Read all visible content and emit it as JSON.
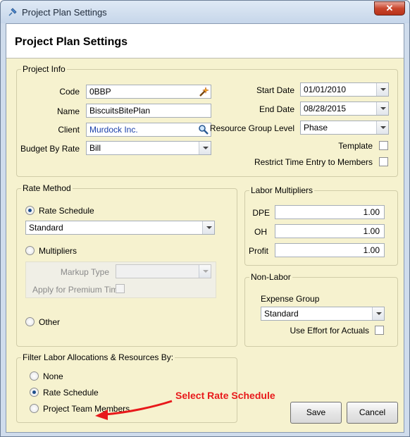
{
  "window": {
    "title": "Project Plan Settings",
    "close_glyph": "✕"
  },
  "header": {
    "title": "Project Plan Settings"
  },
  "project_info": {
    "title": "Project Info",
    "code": {
      "label": "Code",
      "value": "0BBP"
    },
    "name": {
      "label": "Name",
      "value": "BiscuitsBitePlan"
    },
    "client": {
      "label": "Client",
      "value": "Murdock Inc."
    },
    "budget_by_rate": {
      "label": "Budget By Rate",
      "value": "Bill"
    },
    "start_date": {
      "label": "Start Date",
      "value": "01/01/2010"
    },
    "end_date": {
      "label": "End Date",
      "value": "08/28/2015"
    },
    "resource_group_level": {
      "label": "Resource Group Level",
      "value": "Phase"
    },
    "template": {
      "label": "Template",
      "checked": false
    },
    "restrict_time_entry": {
      "label": "Restrict Time Entry to Members",
      "checked": false
    }
  },
  "rate_method": {
    "title": "Rate Method",
    "rate_schedule": {
      "label": "Rate Schedule",
      "selected": true,
      "value": "Standard"
    },
    "multipliers": {
      "label": "Multipliers",
      "selected": false,
      "markup_type_label": "Markup Type",
      "markup_type_value": "",
      "premium_label": "Apply for Premium Time",
      "premium_checked": false
    },
    "other": {
      "label": "Other",
      "selected": false
    }
  },
  "labor_multipliers": {
    "title": "Labor Multipliers",
    "dpe": {
      "label": "DPE",
      "value": "1.00"
    },
    "oh": {
      "label": "OH",
      "value": "1.00"
    },
    "profit": {
      "label": "Profit",
      "value": "1.00"
    }
  },
  "non_labor": {
    "title": "Non-Labor",
    "expense_group_label": "Expense Group",
    "expense_group_value": "Standard",
    "use_effort": {
      "label": "Use Effort for Actuals",
      "checked": false
    }
  },
  "filter": {
    "title": "Filter Labor Allocations & Resources By:",
    "options": [
      {
        "label": "None",
        "selected": false
      },
      {
        "label": "Rate Schedule",
        "selected": true
      },
      {
        "label": "Project Team Members",
        "selected": false
      }
    ]
  },
  "annotation": {
    "text": "Select Rate Schedule",
    "color": "#e8191b"
  },
  "buttons": {
    "save": "Save",
    "cancel": "Cancel"
  },
  "icons": {
    "code_lookup": "magic-wand-icon",
    "client_lookup": "magnifier-icon",
    "app": "pin-icon"
  }
}
